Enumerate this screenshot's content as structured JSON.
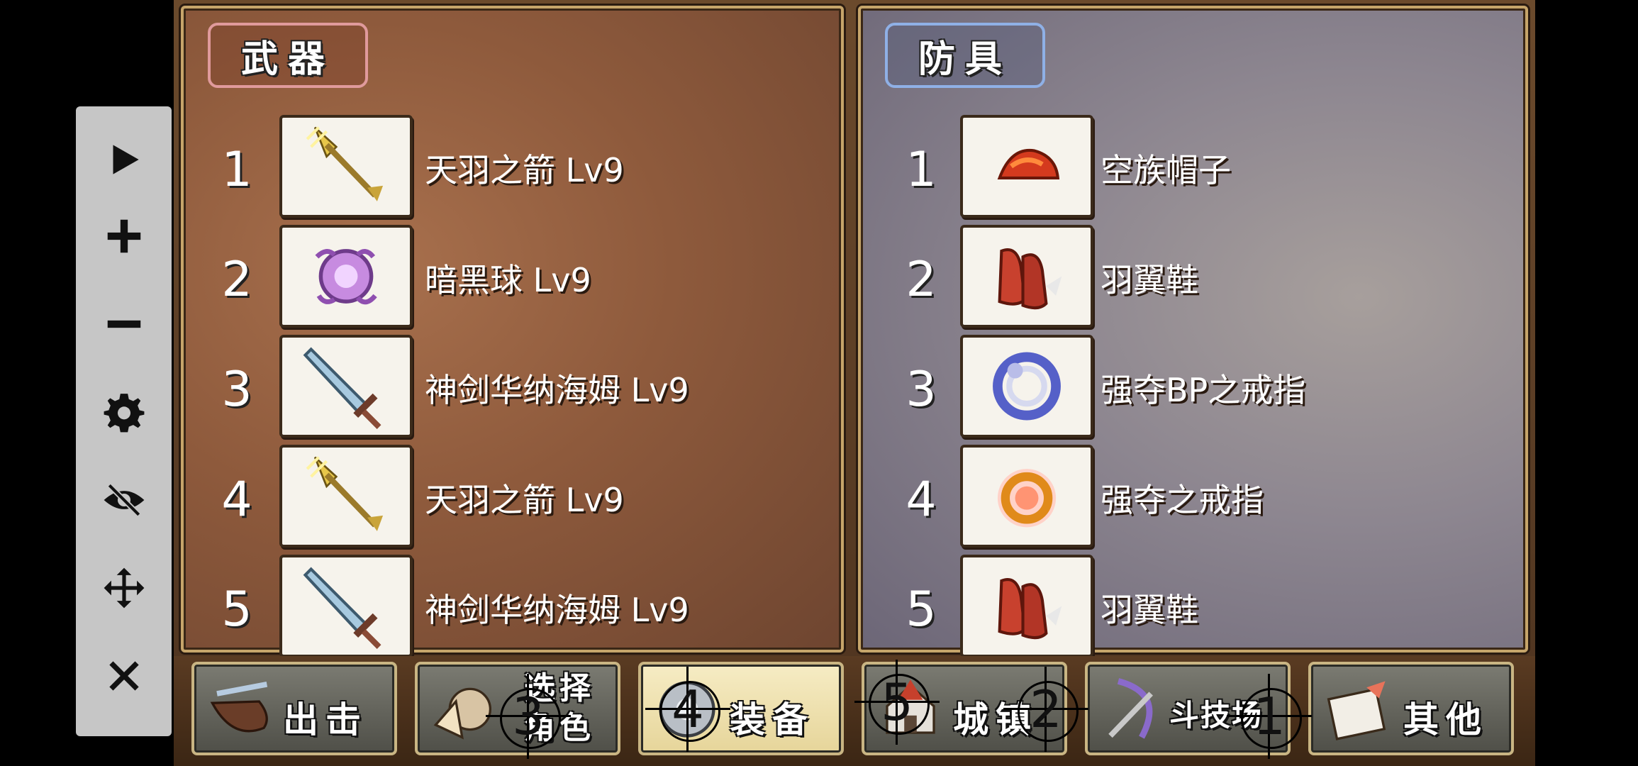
{
  "weapons": {
    "title": "武器",
    "items": [
      {
        "num": "1",
        "name": "天羽之箭 Lv9",
        "icon": "golden-arrow-icon"
      },
      {
        "num": "2",
        "name": "暗黑球 Lv9",
        "icon": "dark-orb-icon"
      },
      {
        "num": "3",
        "name": "神剑华纳海姆 Lv9",
        "icon": "sword-icon"
      },
      {
        "num": "4",
        "name": "天羽之箭 Lv9",
        "icon": "golden-arrow-icon"
      },
      {
        "num": "5",
        "name": "神剑华纳海姆 Lv9",
        "icon": "sword-icon"
      }
    ]
  },
  "armor": {
    "title": "防具",
    "items": [
      {
        "num": "1",
        "name": "空族帽子",
        "icon": "red-hat-icon"
      },
      {
        "num": "2",
        "name": "羽翼鞋",
        "icon": "winged-boots-icon"
      },
      {
        "num": "3",
        "name": "强夺BP之戒指",
        "icon": "blue-ring-icon"
      },
      {
        "num": "4",
        "name": "强夺之戒指",
        "icon": "gold-ring-icon"
      },
      {
        "num": "5",
        "name": "羽翼鞋",
        "icon": "winged-boots-icon"
      }
    ]
  },
  "nav": [
    {
      "label": "出击",
      "icon": "sortie-icon",
      "active": false
    },
    {
      "label": "选择角色",
      "icon": "character-select-icon",
      "active": false
    },
    {
      "label": "装备",
      "icon": "equipment-icon",
      "active": true
    },
    {
      "label": "城镇",
      "icon": "town-icon",
      "active": false
    },
    {
      "label": "斗技场",
      "icon": "arena-icon",
      "active": false
    },
    {
      "label": "其他",
      "icon": "other-icon",
      "active": false
    }
  ],
  "markers": [
    "3",
    "4",
    "5",
    "2",
    "1"
  ],
  "toolbar": [
    "play-icon",
    "zoom-in-icon",
    "zoom-out-icon",
    "settings-icon",
    "hide-icon",
    "move-icon",
    "close-icon"
  ]
}
